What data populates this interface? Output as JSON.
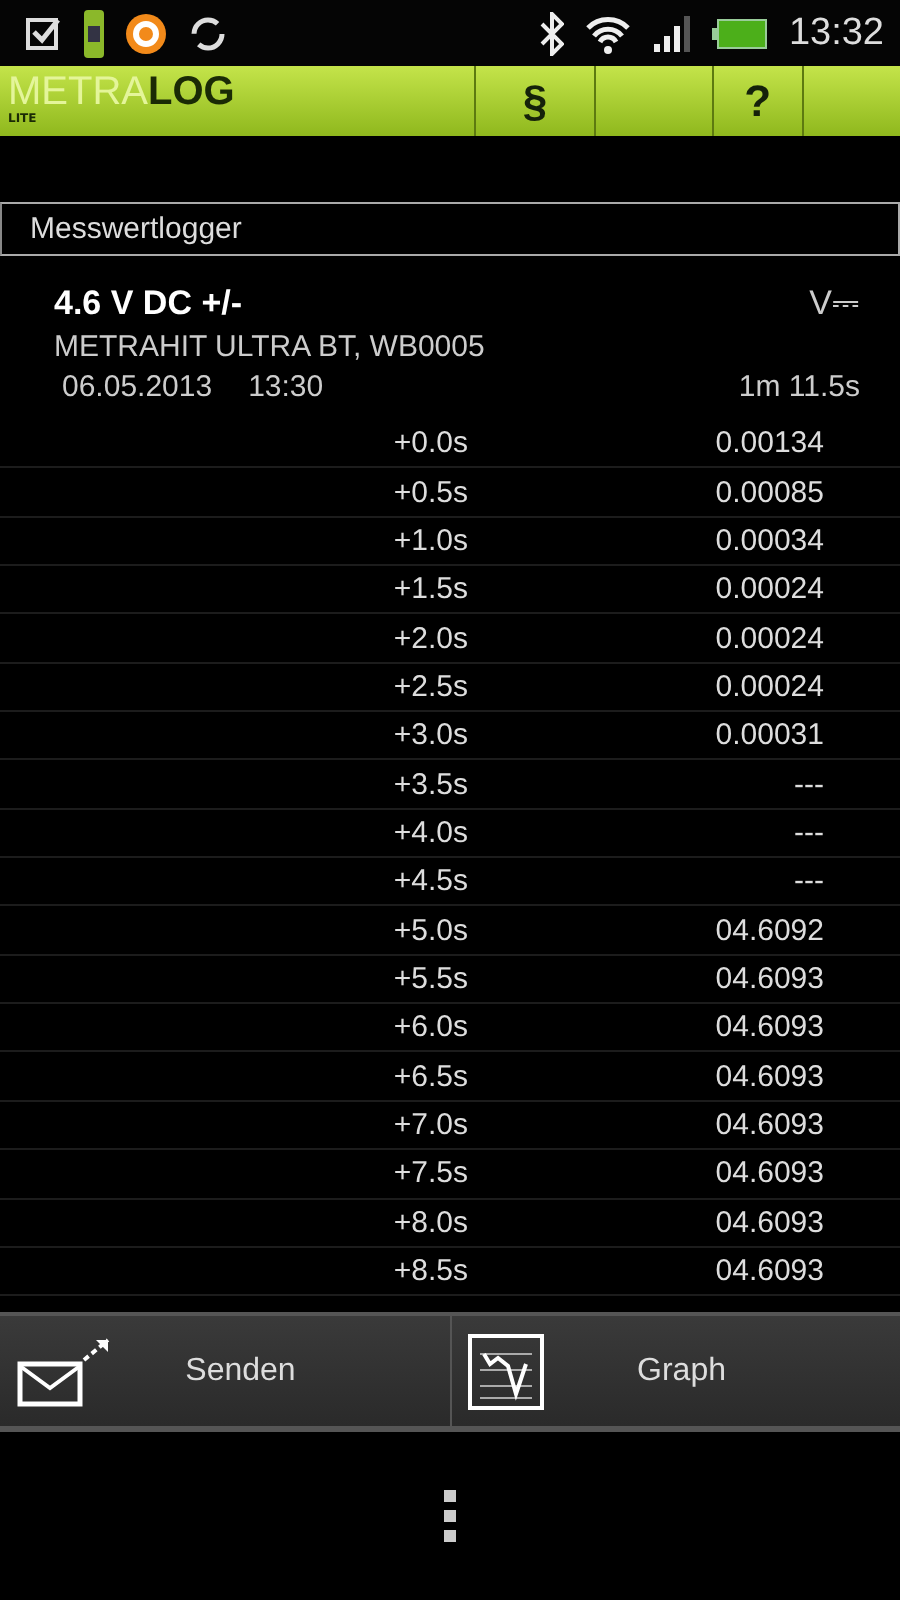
{
  "status_bar": {
    "time": "13:32"
  },
  "app_bar": {
    "logo": {
      "part_1": "METRA",
      "part_2": "LOG",
      "edition": "LITE"
    },
    "actions": [
      {
        "kind": "label",
        "label": "§"
      },
      {
        "kind": "empty"
      },
      {
        "kind": "label",
        "label": "?"
      },
      {
        "kind": "empty"
      }
    ]
  },
  "section_title": "Messwertlogger",
  "measurement": {
    "title": "4.6 V DC +/-",
    "unit_symbol": "V⎓",
    "device": "METRAHIT ULTRA BT, WB0005",
    "date": "06.05.2013",
    "time": "13:30",
    "duration": "1m 11.5s"
  },
  "rows": [
    {
      "offset": "+0.0s",
      "value": "0.00134"
    },
    {
      "offset": "+0.5s",
      "value": "0.00085"
    },
    {
      "offset": "+1.0s",
      "value": "0.00034"
    },
    {
      "offset": "+1.5s",
      "value": "0.00024"
    },
    {
      "offset": "+2.0s",
      "value": "0.00024"
    },
    {
      "offset": "+2.5s",
      "value": "0.00024"
    },
    {
      "offset": "+3.0s",
      "value": "0.00031"
    },
    {
      "offset": "+3.5s",
      "value": "---"
    },
    {
      "offset": "+4.0s",
      "value": "---"
    },
    {
      "offset": "+4.5s",
      "value": "---"
    },
    {
      "offset": "+5.0s",
      "value": "04.6092"
    },
    {
      "offset": "+5.5s",
      "value": "04.6093"
    },
    {
      "offset": "+6.0s",
      "value": "04.6093"
    },
    {
      "offset": "+6.5s",
      "value": "04.6093"
    },
    {
      "offset": "+7.0s",
      "value": "04.6093"
    },
    {
      "offset": "+7.5s",
      "value": "04.6093"
    },
    {
      "offset": "+8.0s",
      "value": "04.6093"
    },
    {
      "offset": "+8.5s",
      "value": "04.6093"
    }
  ],
  "buttons": [
    {
      "kind": "send",
      "label": "Senden"
    },
    {
      "kind": "graph",
      "label": "Graph"
    }
  ]
}
